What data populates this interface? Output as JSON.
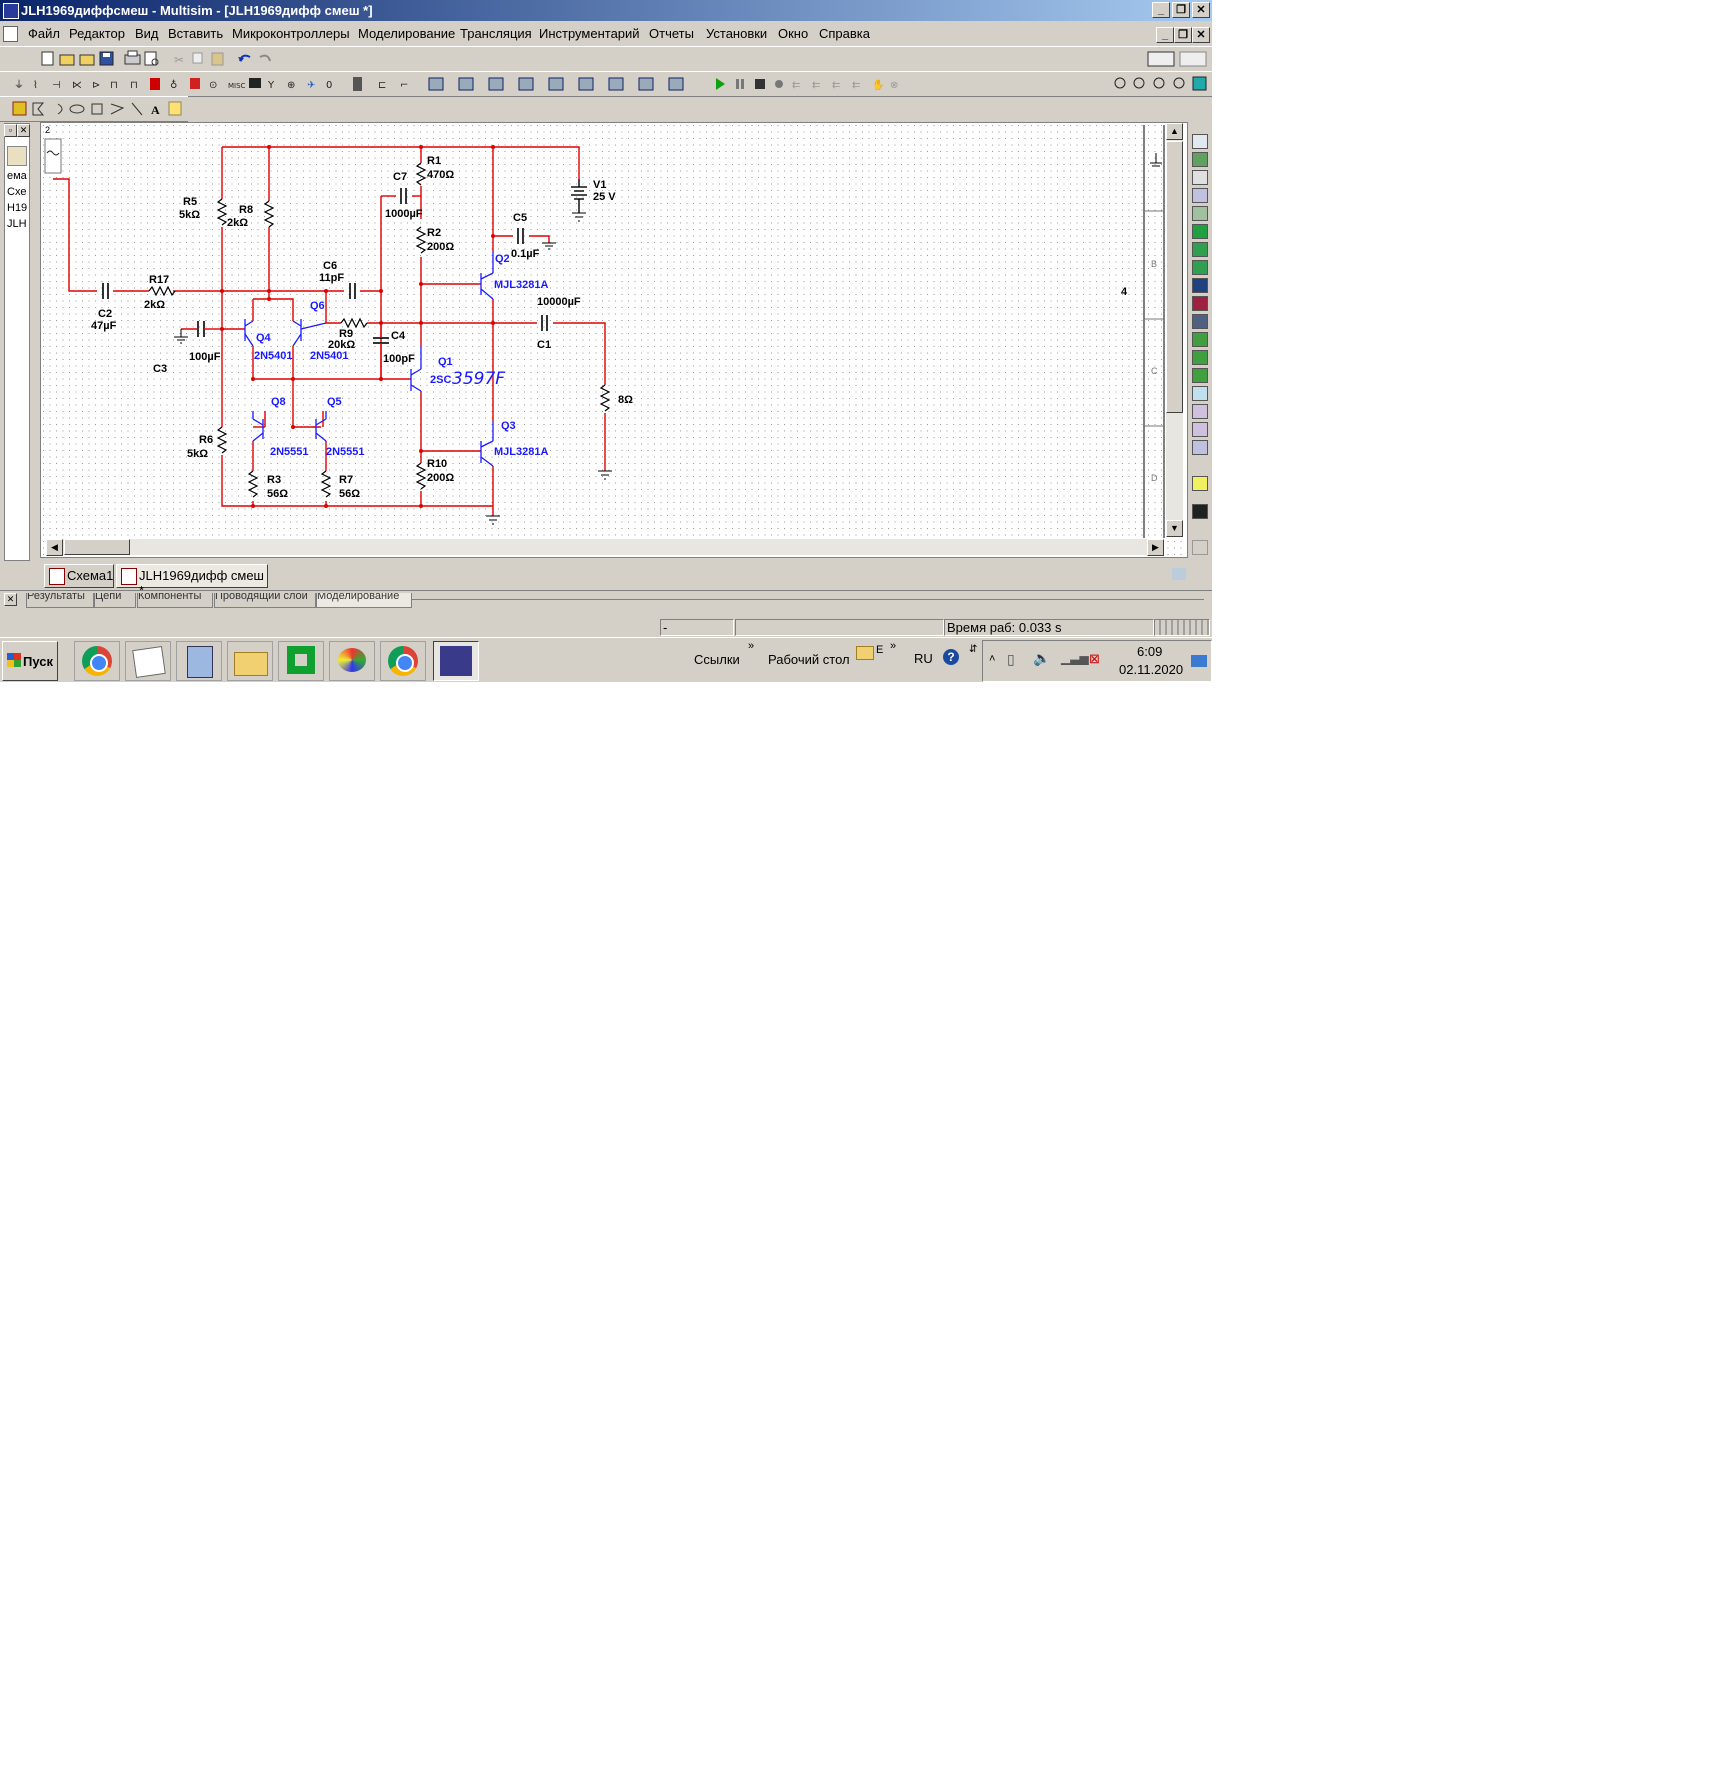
{
  "window": {
    "title": "JLH1969диффсмеш - Multisim - [JLH1969дифф смеш *]"
  },
  "menu": {
    "items": [
      "Файл",
      "Редактор",
      "Вид",
      "Вставить",
      "Микроконтроллеры",
      "Моделирование",
      "Трансляция",
      "Инструментарий",
      "Отчеты",
      "Установки",
      "Окно",
      "Справка"
    ]
  },
  "left_panel": {
    "page": "2",
    "lines": [
      "ема",
      "Схе",
      "Н19",
      "JLH"
    ]
  },
  "schematic": {
    "sheet_label": "2",
    "border_number": "4",
    "border_letters": [
      "B",
      "C",
      "D"
    ],
    "resistors": {
      "R1": {
        "name": "R1",
        "value": "470Ω"
      },
      "R2": {
        "name": "R2",
        "value": "200Ω"
      },
      "R3": {
        "name": "R3",
        "value": "56Ω"
      },
      "R5": {
        "name": "R5",
        "value": "5kΩ"
      },
      "R6": {
        "name": "R6",
        "value": "5kΩ"
      },
      "R7": {
        "name": "R7",
        "value": "56Ω"
      },
      "R8": {
        "name": "R8",
        "value": "2kΩ"
      },
      "R9": {
        "name": "R9",
        "value": "20kΩ"
      },
      "R10": {
        "name": "R10",
        "value": "200Ω"
      },
      "R17": {
        "name": "R17",
        "value": "2kΩ"
      },
      "RL": {
        "value": "8Ω"
      }
    },
    "capacitors": {
      "C1": {
        "name": "C1",
        "value": "10000µF"
      },
      "C2": {
        "name": "C2",
        "value": "47µF"
      },
      "C3": {
        "name": "C3",
        "value": "100µF"
      },
      "C4": {
        "name": "C4",
        "value": "100pF"
      },
      "C5": {
        "name": "C5",
        "value": "0.1µF"
      },
      "C6": {
        "name": "C6",
        "value": "11pF"
      },
      "C7": {
        "name": "C7",
        "value": "1000µF"
      }
    },
    "source": {
      "name": "V1",
      "value": "25 V"
    },
    "transistors": {
      "Q1": {
        "name": "Q1",
        "model": "2SC",
        "handwritten": "3597F"
      },
      "Q2": {
        "name": "Q2",
        "model": "MJL3281A"
      },
      "Q3": {
        "name": "Q3",
        "model": "MJL3281A"
      },
      "Q4": {
        "name": "Q4",
        "model": "2N5401"
      },
      "Q5": {
        "name": "Q5",
        "model": "2N5551"
      },
      "Q6": {
        "name": "Q6",
        "model": "2N5401"
      },
      "Q8": {
        "name": "Q8",
        "model": "2N5551"
      }
    }
  },
  "tabs": [
    {
      "label": "Схема1"
    },
    {
      "label": "JLH1969дифф смеш *"
    }
  ],
  "bottom_tabs": [
    "Результаты",
    "Цепи",
    "Компоненты",
    "Проводящий слой",
    "Моделирование"
  ],
  "status": {
    "field1": "-",
    "run_time": "Время раб: 0.033 s"
  },
  "taskbar": {
    "start": "Пуск",
    "links": "Ссылки",
    "desktop": "Рабочий стол",
    "desktop_extra": "E",
    "lang": "RU",
    "time": "6:09",
    "date": "02.11.2020"
  },
  "colors": {
    "wire_red": "#e00000",
    "component_blue": "#1a1aff",
    "title_blue": "#0a246a"
  }
}
